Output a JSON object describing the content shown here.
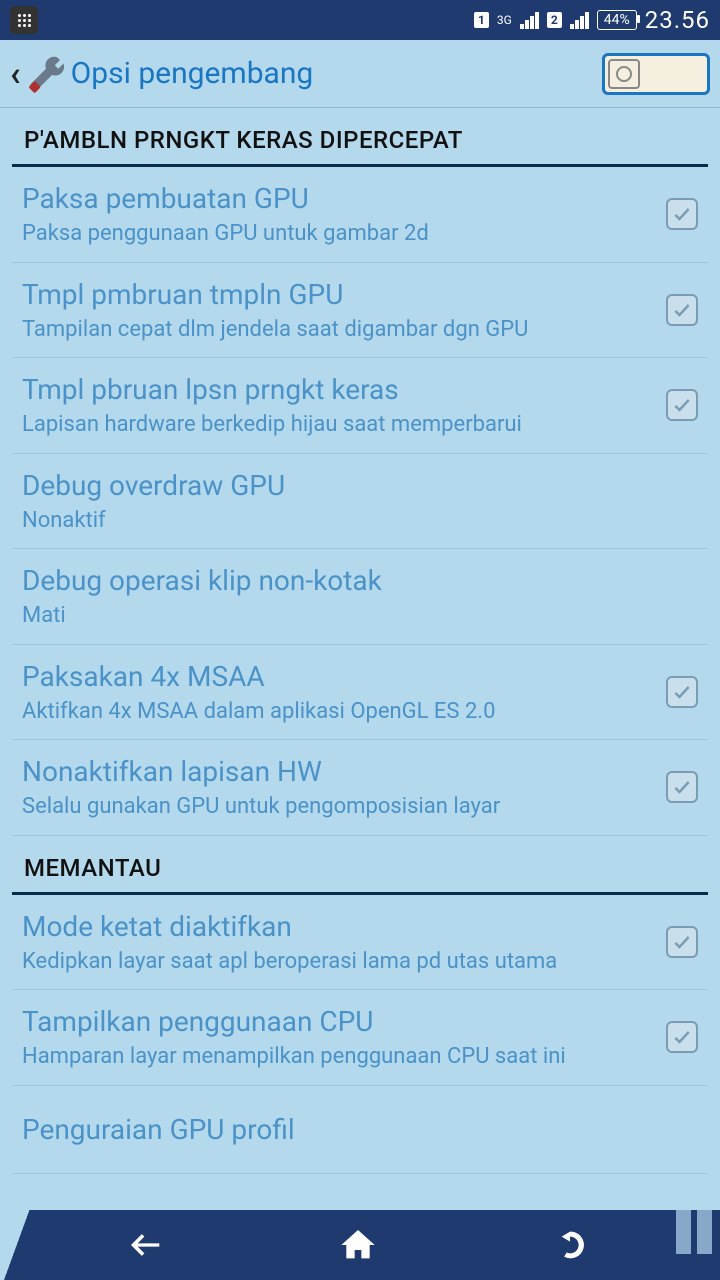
{
  "statusbar": {
    "net": "3G",
    "sim1": "1",
    "sim2": "2",
    "battery": "44%",
    "time": "23.56"
  },
  "appbar": {
    "title": "Opsi pengembang"
  },
  "sections": [
    {
      "header": "P'AMBLN PRNGKT KERAS DIPERCEPAT",
      "items": [
        {
          "title": "Paksa pembuatan GPU",
          "sub": "Paksa penggunaan GPU untuk gambar 2d",
          "check": true
        },
        {
          "title": "Tmpl pmbruan tmpln GPU",
          "sub": "Tampilan cepat dlm jendela saat digambar dgn GPU",
          "check": true
        },
        {
          "title": "Tmpl pbruan lpsn prngkt keras",
          "sub": "Lapisan hardware berkedip hijau saat memperbarui",
          "check": true
        },
        {
          "title": "Debug overdraw GPU",
          "sub": "Nonaktif",
          "check": false
        },
        {
          "title": "Debug operasi klip non-kotak",
          "sub": "Mati",
          "check": false
        },
        {
          "title": "Paksakan 4x MSAA",
          "sub": "Aktifkan 4x MSAA dalam aplikasi OpenGL ES 2.0",
          "check": true
        },
        {
          "title": "Nonaktifkan lapisan HW",
          "sub": "Selalu gunakan GPU untuk pengomposisian layar",
          "check": true
        }
      ]
    },
    {
      "header": "MEMANTAU",
      "items": [
        {
          "title": "Mode ketat diaktifkan",
          "sub": "Kedipkan layar saat apl beroperasi lama pd utas utama",
          "check": true
        },
        {
          "title": "Tampilkan penggunaan CPU",
          "sub": "Hamparan layar menampilkan penggunaan CPU saat ini",
          "check": true
        },
        {
          "title": "Penguraian GPU profil",
          "sub": "",
          "check": false
        }
      ]
    }
  ]
}
